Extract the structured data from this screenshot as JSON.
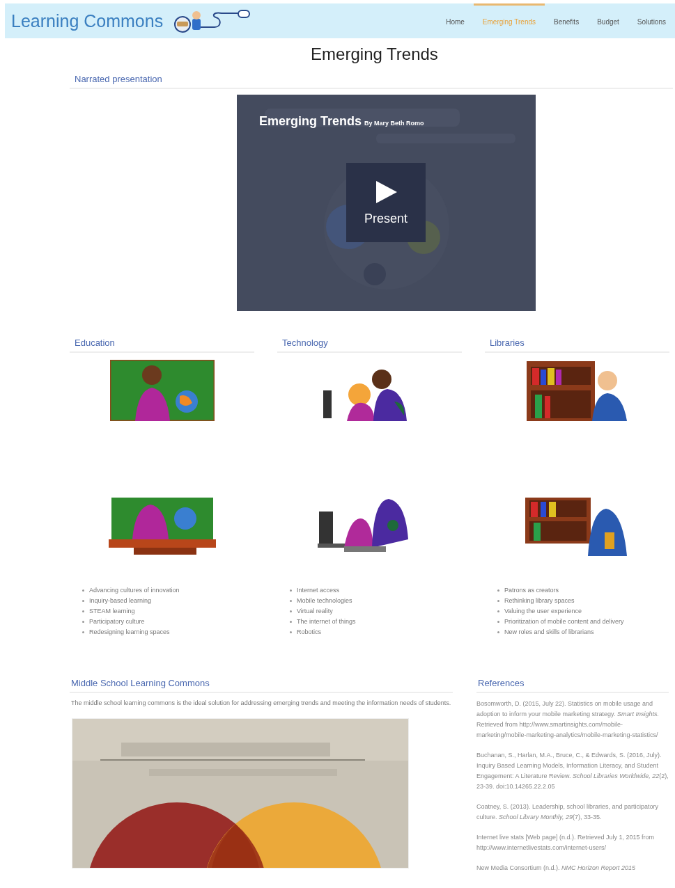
{
  "header": {
    "site_title": "Learning Commons",
    "nav": [
      {
        "label": "Home",
        "selected": false
      },
      {
        "label": "Emerging Trends",
        "selected": true
      },
      {
        "label": "Benefits",
        "selected": false
      },
      {
        "label": "Budget",
        "selected": false
      },
      {
        "label": "Solutions",
        "selected": false
      }
    ]
  },
  "page_title": "Emerging Trends",
  "presentation": {
    "heading": "Narrated presentation",
    "title": "Emerging Trends",
    "author": "By Mary Beth Romo",
    "button": "Present"
  },
  "columns": [
    {
      "heading": "Education",
      "kind": "education",
      "items": [
        "Advancing cultures of innovation",
        "Inquiry-based learning",
        "STEAM learning",
        "Participatory culture",
        "Redesigning learning spaces"
      ]
    },
    {
      "heading": "Technology",
      "kind": "technology",
      "items": [
        "Internet access",
        "Mobile technologies",
        "Virtual reality",
        "The internet of things",
        "Robotics"
      ]
    },
    {
      "heading": "Libraries",
      "kind": "libraries",
      "items": [
        "Patrons as creators",
        "Rethinking library spaces",
        "Valuing the user experience",
        "Prioritization of mobile content and delivery",
        "New roles and skills of librarians"
      ]
    }
  ],
  "main": {
    "heading": "Middle School Learning Commons",
    "text": "The middle school learning commons is the ideal solution for addressing emerging trends and meeting the information needs of students."
  },
  "references": {
    "heading": "References",
    "items": [
      "Bosomworth, D. (2015, July 22). Statistics on mobile usage and adoption to inform your mobile marketing strategy. *Smart Insights.* Retrieved from http://www.smartinsights.com/mobile-marketing/mobile-marketing-analytics/mobile-marketing-statistics/",
      "Buchanan, S., Harlan, M.A., Bruce, C., & Edwards, S. (2016, July). Inquiry Based Learning Models, Information Literacy, and Student Engagement: A Literature Review. *School Libraries Worldwide, 22*(2), 23-39. doi:10.14265.22.2.05",
      "Coatney, S. (2013). Leadership, school libraries, and participatory culture. *School Library Monthly, 29*(7), 33-35.",
      "Internet live stats [Web page] (n.d.). Retrieved July 1, 2015 from http://www.internetlivestats.com/internet-users/",
      "New Media Consortium (n.d.). *NMC Horizon Report 2015*"
    ]
  }
}
